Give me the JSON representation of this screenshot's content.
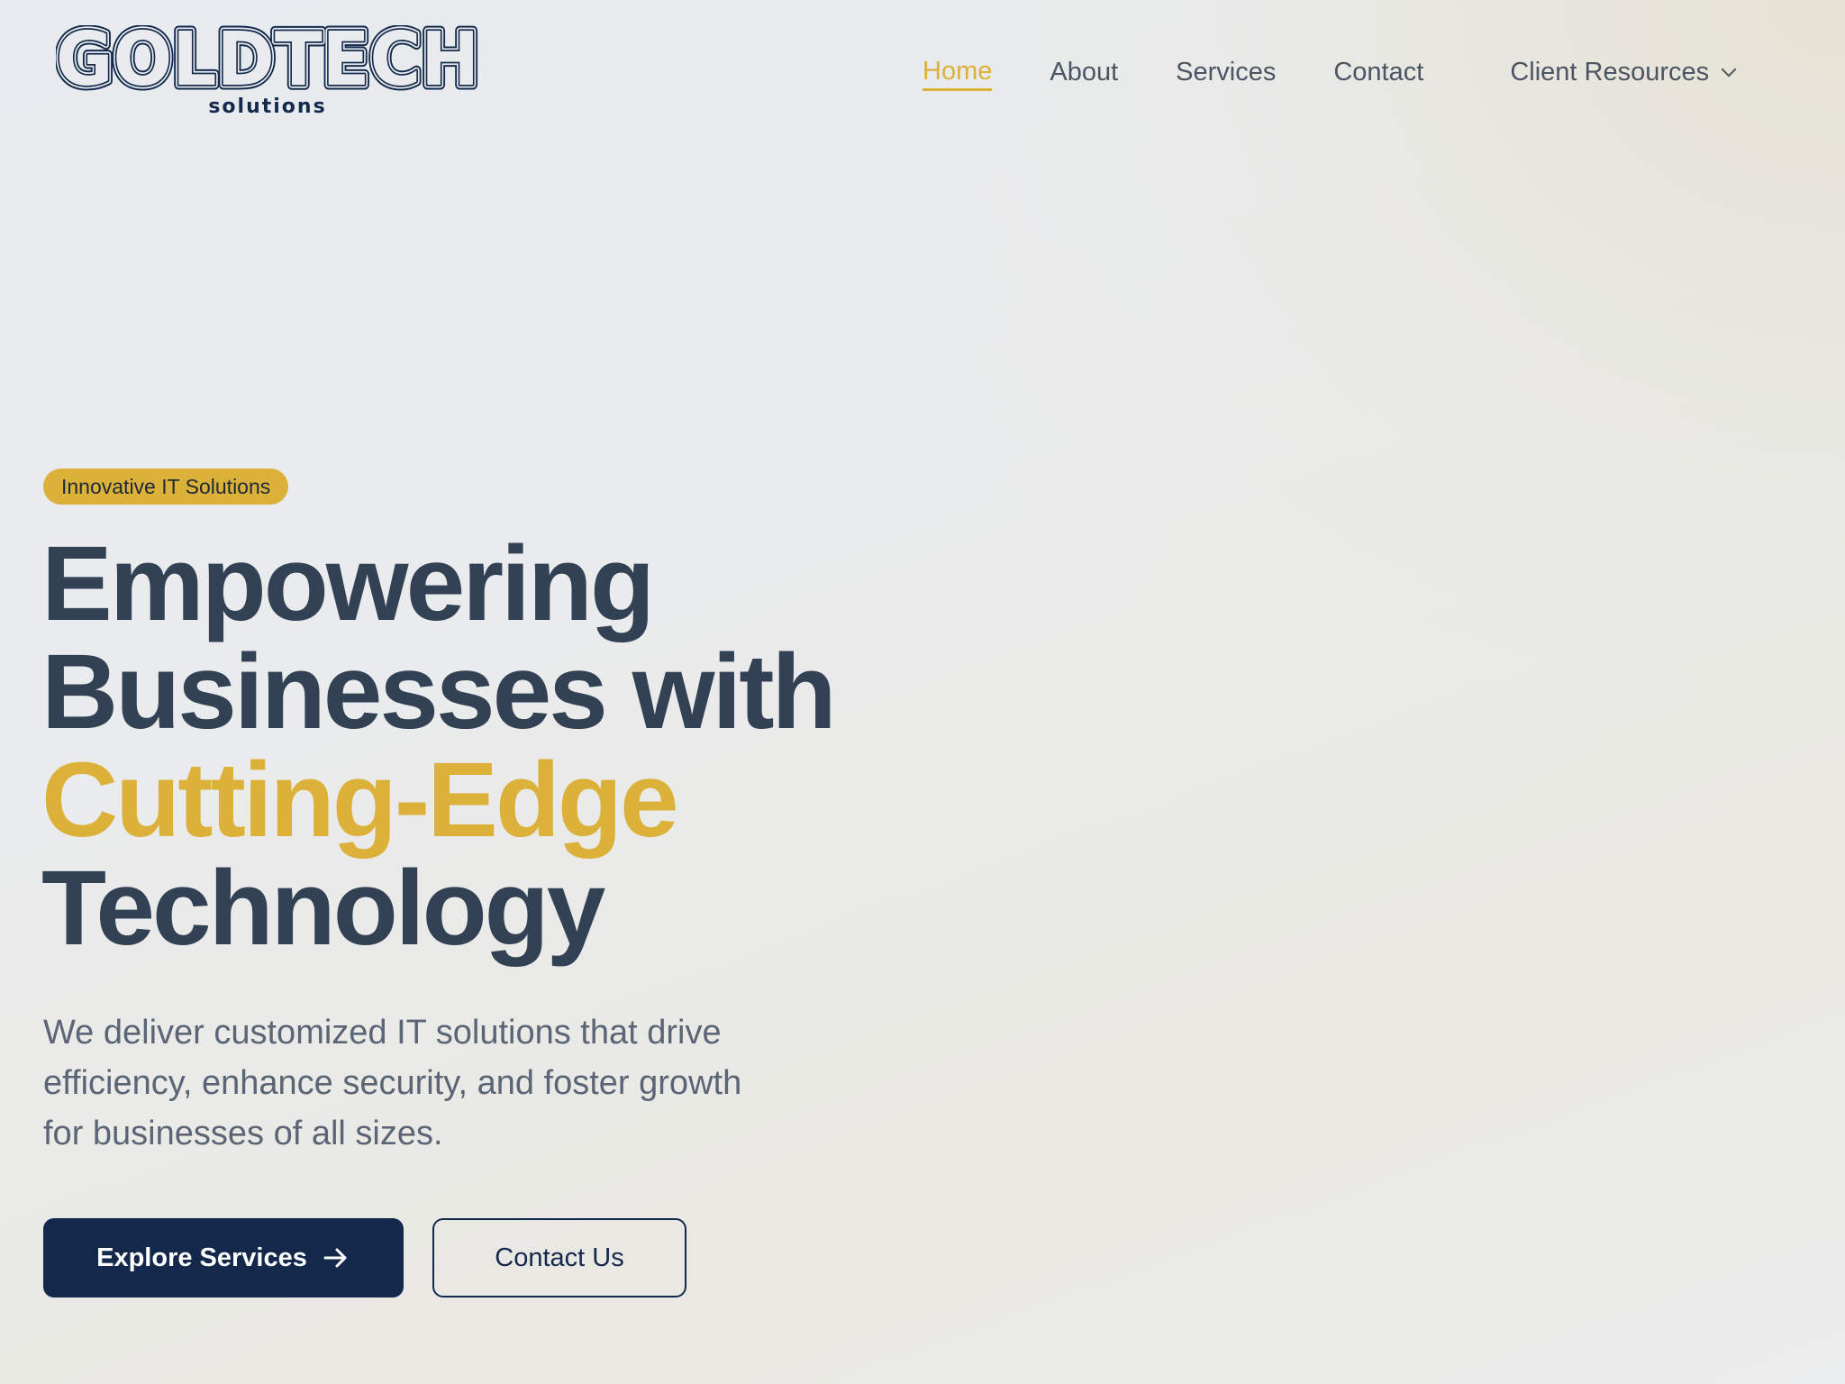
{
  "brand": {
    "name": "GOLDTECH",
    "sub": "solutions"
  },
  "nav": {
    "items": [
      {
        "label": "Home",
        "active": true
      },
      {
        "label": "About"
      },
      {
        "label": "Services"
      },
      {
        "label": "Contact"
      },
      {
        "label": "Client Resources",
        "icon": "chevron-down-icon"
      }
    ]
  },
  "hero": {
    "badge": "Innovative IT Solutions",
    "headline": {
      "part1": "Empowering Businesses with ",
      "highlight": "Cutting-Edge",
      "part2": " Technology"
    },
    "subtext": "We deliver customized IT solutions that drive efficiency, enhance security, and foster growth for businesses of all sizes.",
    "primary_cta": "Explore Services",
    "primary_cta_icon": "arrow-right-icon",
    "secondary_cta": "Contact Us"
  },
  "colors": {
    "accent": "#dcb13a",
    "navy": "#13284b",
    "heading": "#334155",
    "body_text": "#5b6575",
    "nav_text": "#4b5563"
  }
}
